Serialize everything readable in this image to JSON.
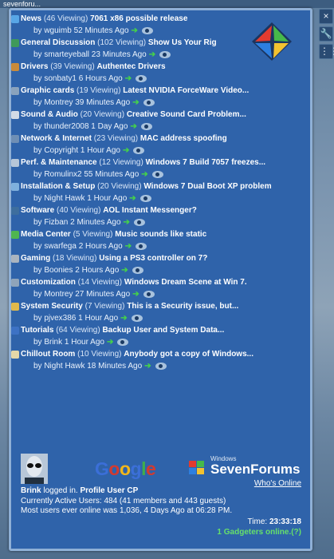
{
  "window": {
    "caption": "sevenforu..."
  },
  "rail": {
    "close_glyph": "×",
    "settings_glyph": "🔧",
    "drag_glyph": "⋮⋮"
  },
  "threads": [
    {
      "cat": "News",
      "views": "(46 Viewing)",
      "title": "7061 x86 possible release",
      "by": "by wguimb 52 Minutes Ago",
      "icon": "globe-icon",
      "color": "#58a6e6"
    },
    {
      "cat": "General Discussion",
      "views": "(102 Viewing)",
      "title": "Show Us Your Rig",
      "by": "by smarteyeball 23 Minutes Ago",
      "icon": "people-icon",
      "color": "#3f9a5a"
    },
    {
      "cat": "Drivers",
      "views": "(39 Viewing)",
      "title": "Authentec Drivers",
      "by": "by sonbaty1 6 Hours Ago",
      "icon": "driver-icon",
      "color": "#c98b3a"
    },
    {
      "cat": "Graphic cards",
      "views": "(19 Viewing)",
      "title": "Latest NVIDIA ForceWare Video...",
      "by": "by Montrey 39 Minutes Ago",
      "icon": "graphics-card-icon",
      "color": "#8aa3bd"
    },
    {
      "cat": "Sound & Audio",
      "views": "(20 Viewing)",
      "title": "Creative Sound Card Problem...",
      "by": "by thunder2008 1 Day Ago",
      "icon": "speaker-icon",
      "color": "#d2dbe6"
    },
    {
      "cat": "Network & Internet",
      "views": "(23 Viewing)",
      "title": "MAC address spoofing",
      "by": "by Copyright 1 Hour Ago",
      "icon": "network-icon",
      "color": "#6f8fb5"
    },
    {
      "cat": "Perf. & Maintenance",
      "views": "(12 Viewing)",
      "title": "Windows 7 Build 7057 freezes...",
      "by": "by Romulinx2 55 Minutes Ago",
      "icon": "performance-icon",
      "color": "#b6c6d8"
    },
    {
      "cat": "Installation & Setup",
      "views": "(20 Viewing)",
      "title": "Windows 7 Dual Boot XP problem",
      "by": "by Night Hawk 1 Hour Ago",
      "icon": "setup-icon",
      "color": "#7fb0dd"
    },
    {
      "cat": "Software",
      "views": "(40 Viewing)",
      "title": "AOL Instant Messenger?",
      "by": "by Fizban 2 Minutes Ago",
      "icon": "software-icon",
      "color": "#3e6e9e"
    },
    {
      "cat": "Media Center",
      "views": "(5 Viewing)",
      "title": "Music sounds like static",
      "by": "by swarfega 2 Hours Ago",
      "icon": "media-center-icon",
      "color": "#4fb54f"
    },
    {
      "cat": "Gaming",
      "views": "(18 Viewing)",
      "title": "Using a PS3 controller on 7?",
      "by": "by Boonies 2 Hours Ago",
      "icon": "gamepad-icon",
      "color": "#aab4bf"
    },
    {
      "cat": "Customization",
      "views": "(14 Viewing)",
      "title": "Windows Dream Scene at Win 7.",
      "by": "by Montrey 27 Minutes Ago",
      "icon": "customization-icon",
      "color": "#8fa4ba"
    },
    {
      "cat": "System Security",
      "views": "(7 Viewing)",
      "title": "This is a Security issue, but...",
      "by": "by pjvex386 1 Hour Ago",
      "icon": "shield-icon",
      "color": "#e0b94b"
    },
    {
      "cat": "Tutorials",
      "views": "(64 Viewing)",
      "title": "Backup User and System Data...",
      "by": "by Brink 1 Hour Ago",
      "icon": "tutorial-book-icon",
      "color": "#3d72c4"
    },
    {
      "cat": "Chillout Room",
      "views": "(10 Viewing)",
      "title": "Anybody got a copy of Windows...",
      "by": "by Night Hawk 18 Minutes Ago",
      "icon": "chillout-icon",
      "color": "#e4d7a8"
    }
  ],
  "footer": {
    "google_text": "Google",
    "sevenforums_small": "Windows",
    "sevenforums_big": "SevenForums",
    "whos_online": "Who's Online",
    "user": "Brink",
    "logged_in_text": "logged in.",
    "profile": "Profile",
    "user_cp": "User CP",
    "active_users": "Currently Active Users: 484 (41 members and 443 guests)",
    "most_users": "Most users ever online was 1,036, 4 Days Ago at 06:28 PM.",
    "time_label": "Time:",
    "time_value": "23:33:18",
    "gadgeters": "1 Gadgeters online.(?)"
  }
}
